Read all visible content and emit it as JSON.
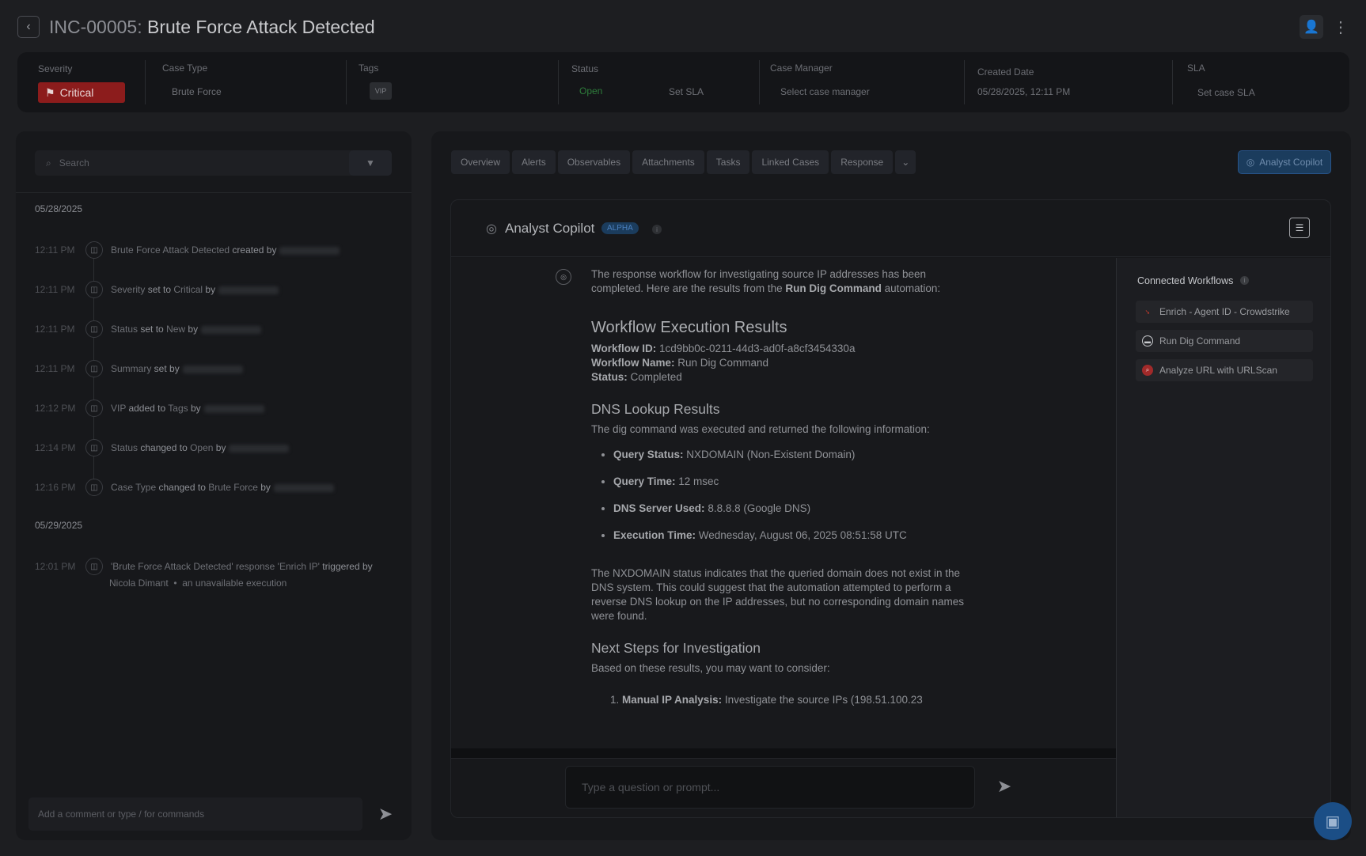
{
  "header": {
    "incident_id": "INC-00005:",
    "title": "Brute Force Attack Detected"
  },
  "meta": {
    "severity_label": "Severity",
    "severity_value": "Critical",
    "case_type_label": "Case Type",
    "case_type_value": "Brute Force",
    "tags_label": "Tags",
    "tag_vip": "VIP",
    "status_label": "Status",
    "status_value": "Open",
    "status_sla": "Set SLA",
    "case_manager_label": "Case Manager",
    "case_manager_value": "Select case manager",
    "created_label": "Created Date",
    "created_value": "05/28/2025, 12:11 PM",
    "sla_label": "SLA",
    "sla_value": "Set case SLA"
  },
  "timeline": {
    "search_placeholder": "Search",
    "groups": [
      {
        "date": "05/28/2025",
        "events": [
          {
            "time": "12:11 PM",
            "parts": [
              "Brute Force Attack Detected",
              " created by"
            ]
          },
          {
            "time": "12:11 PM",
            "parts": [
              "Severity",
              " set to ",
              "Critical",
              " by"
            ]
          },
          {
            "time": "12:11 PM",
            "parts": [
              "Status",
              " set to ",
              "New",
              " by"
            ]
          },
          {
            "time": "12:11 PM",
            "parts": [
              "Summary",
              " set by"
            ]
          },
          {
            "time": "12:12 PM",
            "parts": [
              "VIP",
              " added to ",
              "Tags",
              " by"
            ]
          },
          {
            "time": "12:14 PM",
            "parts": [
              "Status",
              " changed to ",
              "Open",
              " by"
            ]
          },
          {
            "time": "12:16 PM",
            "parts": [
              "Case Type",
              " changed to ",
              "Brute Force",
              " by"
            ]
          }
        ]
      },
      {
        "date": "05/29/2025",
        "events": [
          {
            "time": "12:01 PM",
            "line1_a": "'Brute Force Attack Detected' response 'Enrich IP'",
            "line1_b": " triggered by",
            "line2_a": "Nicola Dimant",
            "line2_sep": "•",
            "line2_b": "an unavailable execution"
          }
        ]
      }
    ],
    "comment_placeholder": "Add a comment or type / for commands"
  },
  "tabs": [
    "Overview",
    "Alerts",
    "Observables",
    "Attachments",
    "Tasks",
    "Linked Cases",
    "Response"
  ],
  "copilot_button": "Analyst Copilot",
  "copilot": {
    "name": "Analyst Copilot",
    "badge": "ALPHA",
    "intro_a": "The response workflow for investigating source IP addresses has been completed. Here are the results from the ",
    "intro_b": "Run Dig Command",
    "intro_c": " automation:",
    "h_results": "Workflow Execution Results",
    "wf_id_label": "Workflow ID:",
    "wf_id_value": " 1cd9bb0c-0211-44d3-ad0f-a8cf3454330a",
    "wf_name_label": "Workflow Name:",
    "wf_name_value": " Run Dig Command",
    "status_label": "Status:",
    "status_value": " Completed",
    "h_dns": "DNS Lookup Results",
    "dns_intro": "The dig command was executed and returned the following information:",
    "dns_items": [
      {
        "k": "Query Status:",
        "v": " NXDOMAIN (Non-Existent Domain)"
      },
      {
        "k": "Query Time:",
        "v": " 12 msec"
      },
      {
        "k": "DNS Server Used:",
        "v": " 8.8.8.8 (Google DNS)"
      },
      {
        "k": "Execution Time:",
        "v": " Wednesday, August 06, 2025 08:51:58 UTC"
      }
    ],
    "nx_para": "The NXDOMAIN status indicates that the queried domain does not exist in the DNS system. This could suggest that the automation attempted to perform a reverse DNS lookup on the IP addresses, but no corresponding domain names were found.",
    "h_next": "Next Steps for Investigation",
    "next_intro": "Based on these results, you may want to consider:",
    "next_item_num": "1.",
    "next_item_label": "Manual IP Analysis:",
    "next_item_text": " Investigate the source IPs (198.51.100.23",
    "prompt_placeholder": "Type a question or prompt..."
  },
  "workflows": {
    "title": "Connected Workflows",
    "items": [
      {
        "label": "Enrich - Agent ID - Crowdstrike",
        "icon": "crowdstrike-icon"
      },
      {
        "label": "Run Dig Command",
        "icon": "dig-icon"
      },
      {
        "label": "Analyze URL with URLScan",
        "icon": "urlscan-icon"
      }
    ]
  },
  "colors": {
    "severity": "#8c1c1c",
    "status_open": "#2e7d3b",
    "accent": "#1b3c5d"
  }
}
